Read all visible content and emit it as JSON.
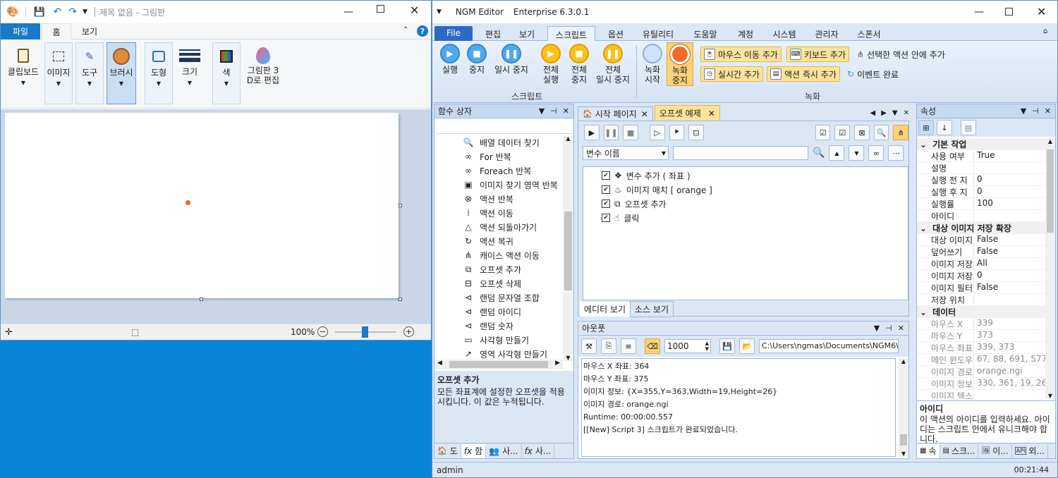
{
  "paint": {
    "title": "제목 없음 - 그림판",
    "tabs": [
      "파일",
      "홈",
      "보기"
    ],
    "tools": [
      "클립보드",
      "이미지",
      "도구",
      "브러시",
      "도형",
      "크기",
      "색",
      "그림판 3\nD로 편집"
    ],
    "zoom": "100%"
  },
  "ngm": {
    "app_title": "NGM Editor",
    "edition": "Enterprise 6.3.0.1",
    "menu": [
      "File",
      "편집",
      "보기",
      "스크립트",
      "옵션",
      "유틸리티",
      "도움말",
      "계정",
      "시스템",
      "관리자",
      "스폰서"
    ],
    "ribbon": {
      "run": "실행",
      "stop": "중지",
      "pause": "일시 중지",
      "all_run": "전체\n실행",
      "all_stop": "전체\n중지",
      "all_pause": "전체\n일시 중지",
      "rec_start": "녹화\n시작",
      "rec_stop": "녹화\n중지",
      "mouse_move": "마우스 이동 추가",
      "keyboard": "키보드 추가",
      "in_selected": "선택한 액션 안에 추가",
      "realtime": "실시간 추가",
      "action_now": "액션 즉시 추가",
      "event_done": "이벤트 완료",
      "group_script": "스크립트",
      "group_rec": "녹화"
    },
    "func_panel": {
      "title": "함수 상자",
      "items": [
        {
          "icon": "search-icon",
          "glyph": "🔍",
          "label": "배열 데이터 찾기"
        },
        {
          "icon": "loop-icon",
          "glyph": "∞",
          "label": "For 반복"
        },
        {
          "icon": "loop-icon",
          "glyph": "∞",
          "label": "Foreach 반복"
        },
        {
          "icon": "image-search-icon",
          "glyph": "▣",
          "label": "이미지 찾기 영역 반복"
        },
        {
          "icon": "repeat-icon",
          "glyph": "⊗",
          "label": "액션 반복"
        },
        {
          "icon": "move-icon",
          "glyph": "⁞",
          "label": "액션 이동"
        },
        {
          "icon": "revert-icon",
          "glyph": "△",
          "label": "액션 되돌아가기"
        },
        {
          "icon": "restore-icon",
          "glyph": "↻",
          "label": "액션 복귀"
        },
        {
          "icon": "case-icon",
          "glyph": "⋔",
          "label": "캐이스 액션 이동"
        },
        {
          "icon": "offset-add-icon",
          "glyph": "⧉",
          "label": "오프셋 추가"
        },
        {
          "icon": "offset-delete-icon",
          "glyph": "⊟",
          "label": "오프셋 삭제"
        },
        {
          "icon": "share-icon",
          "glyph": "⊲",
          "label": "랜덤 문자열 조합"
        },
        {
          "icon": "share-icon",
          "glyph": "⊲",
          "label": "랜덤 아이디"
        },
        {
          "icon": "share-icon",
          "glyph": "⊲",
          "label": "랜덤 숫자"
        },
        {
          "icon": "rect-icon",
          "glyph": "▭",
          "label": "사각형 만들기"
        },
        {
          "icon": "area-rect-icon",
          "glyph": "↗",
          "label": "영역 사각형 만들기"
        }
      ],
      "desc_title": "오프셋 추가",
      "desc_text": "모든 좌표계에 설정한 오프셋을 적용시킵니다. 이 값은 누적됩니다.",
      "bottom_tabs": [
        "도",
        "함",
        "사...",
        "사..."
      ]
    },
    "doc_tabs": [
      "시작 페이지",
      "오프셋 예제"
    ],
    "editor": {
      "var_select": "변수 이름",
      "actions": [
        "변수 추가 ( 좌표 )",
        "이미지 매치 [ orange ]",
        "오프셋 추가",
        "클릭"
      ],
      "view_tabs": [
        "에디터 보기",
        "소스 보기"
      ]
    },
    "output": {
      "title": "아웃풋",
      "interval": "1000",
      "path": "C:\\Users\\ngmas\\Documents\\NGM6\\",
      "lines": [
        "마우스 X 좌표: 364",
        "마우스 Y 좌표: 375",
        "이미지 정보: {X=355,Y=363,Width=19,Height=26}",
        "이미지 경로: orange.ngi",
        "Runtime: 00:00:00.557",
        "[[New] Script 3] 스크립트가 완료되었습니다."
      ]
    },
    "props": {
      "title": "속성",
      "cat1": "기본 작업",
      "rows1": [
        [
          "사용 여부",
          "True"
        ],
        [
          "설명",
          ""
        ],
        [
          "실행 전 지",
          "0"
        ],
        [
          "실행 후 지",
          "0"
        ],
        [
          "실행률",
          "100"
        ],
        [
          "아이디",
          ""
        ]
      ],
      "cat2": "대상 이미지 저장 확장",
      "rows2": [
        [
          "대상 이미지",
          "False"
        ],
        [
          "덮어쓰기",
          "False"
        ],
        [
          "이미지 저장",
          "All"
        ],
        [
          "이미지 저장",
          "0"
        ],
        [
          "이미지 필터",
          "False"
        ],
        [
          "저장 위치",
          ""
        ]
      ],
      "cat3": "데이터",
      "rows3": [
        [
          "마우스 X",
          "339"
        ],
        [
          "마우스 Y",
          "373"
        ],
        [
          "마우스 좌표",
          "339, 373"
        ],
        [
          "메인 윈도우",
          "67, 88, 691, 577"
        ],
        [
          "이미지 경로",
          "orange.ngi"
        ],
        [
          "이미지 정보",
          "330, 361, 19, 26"
        ],
        [
          "이미지 텍스트",
          ""
        ]
      ],
      "desc_title": "아이디",
      "desc_text": "이 액션의 아이디를 입력하세요. 아이디는 스크립트 안에서 유니크해야 합니다.",
      "bottom_tabs": [
        "속",
        "스크...",
        "이...",
        "외..."
      ]
    },
    "status_user": "admin",
    "status_time": "00:21:44"
  }
}
